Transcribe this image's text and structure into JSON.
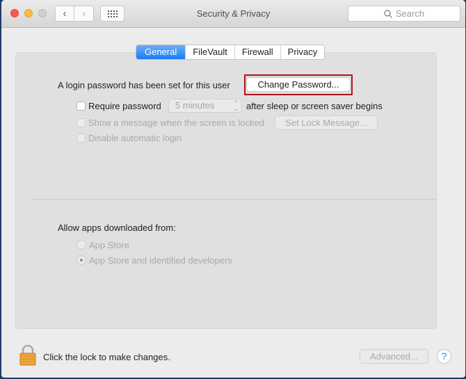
{
  "window": {
    "title": "Security & Privacy",
    "search_placeholder": "Search",
    "back_icon": "‹",
    "forward_icon": "›"
  },
  "tabs": [
    {
      "label": "General",
      "active": true
    },
    {
      "label": "FileVault",
      "active": false
    },
    {
      "label": "Firewall",
      "active": false
    },
    {
      "label": "Privacy",
      "active": false
    }
  ],
  "general": {
    "login_password_text": "A login password has been set for this user",
    "change_password_button": "Change Password...",
    "require_password_label": "Require password",
    "require_password_checked": false,
    "require_password_delay": "5 minutes",
    "after_sleep_text": "after sleep or screen saver begins",
    "show_message_label": "Show a message when the screen is locked",
    "set_lock_message_button": "Set Lock Message...",
    "disable_auto_login_label": "Disable automatic login"
  },
  "allow_apps": {
    "heading": "Allow apps downloaded from:",
    "options": [
      {
        "label": "App Store",
        "selected": false
      },
      {
        "label": "App Store and identified developers",
        "selected": true
      }
    ]
  },
  "footer": {
    "lock_text": "Click the lock to make changes.",
    "advanced_button": "Advanced...",
    "help_button": "?"
  },
  "colors": {
    "accent": "#1b7cf3",
    "focus_ring": "#b0141e",
    "lock": "#f0a43a"
  }
}
